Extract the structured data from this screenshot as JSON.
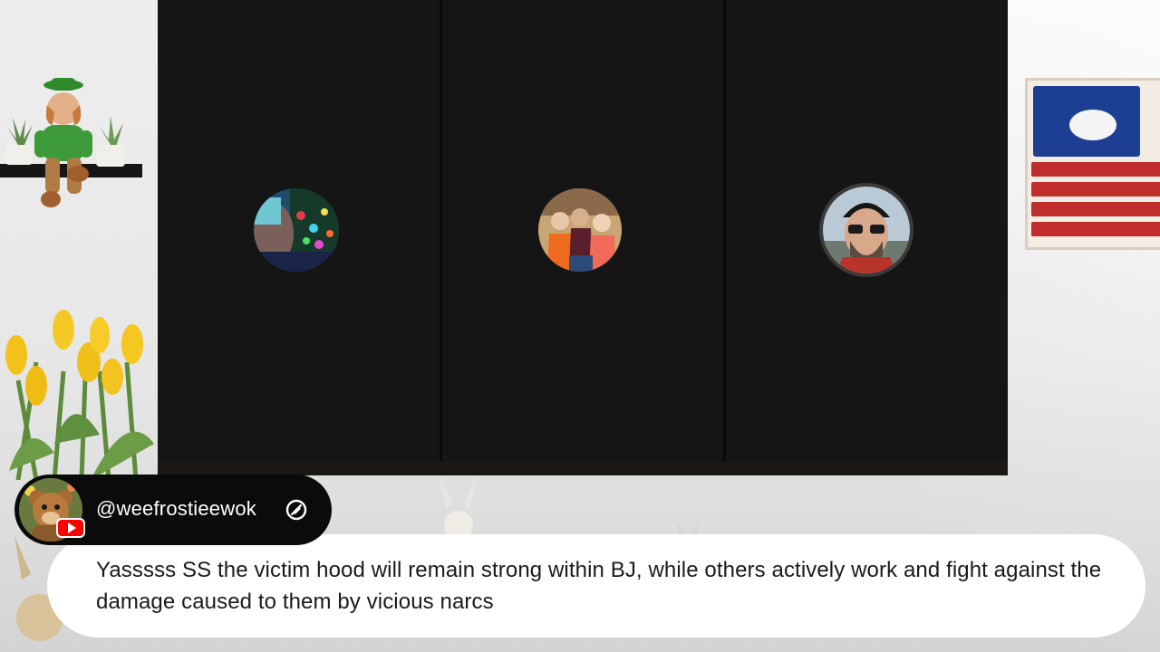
{
  "call": {
    "participants": [
      {
        "avatar_icon": "participant-photo-1",
        "alt": ""
      },
      {
        "avatar_icon": "participant-photo-2",
        "alt": ""
      },
      {
        "avatar_icon": "participant-photo-3",
        "alt": ""
      }
    ],
    "colors": {
      "panel": "#0d0d0d",
      "tile": "#151515"
    }
  },
  "chat": {
    "author": {
      "handle": "@weefrostieewok",
      "platform_icon": "youtube-icon",
      "badge_icon": "moderator-icon"
    },
    "message": "Yasssss SS the victim hood will remain strong within BJ, while others actively work and fight against the damage caused to them by vicious narcs",
    "colors": {
      "pill": "#0b0b0b",
      "bubble": "#ffffff",
      "text": "#1a1a1a",
      "platform": "#ff0000"
    }
  }
}
